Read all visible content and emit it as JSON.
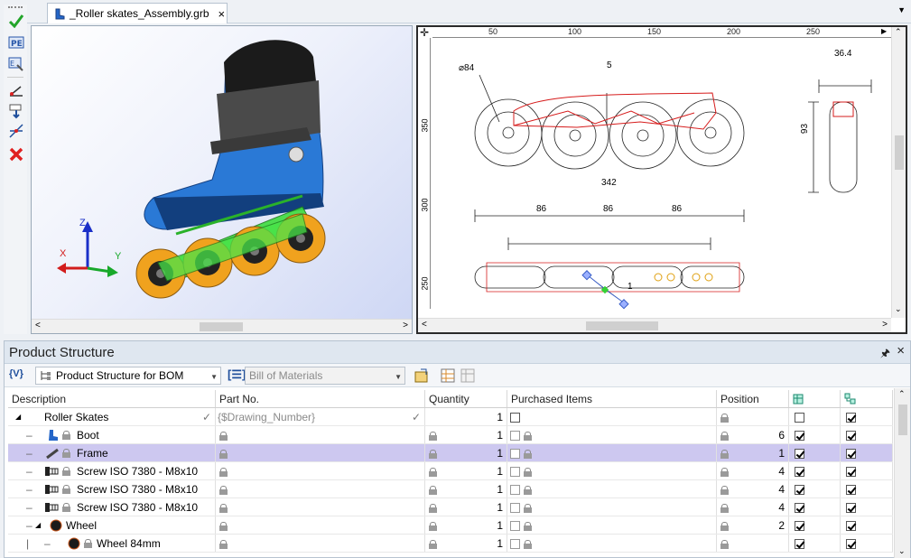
{
  "document_tab": {
    "title": "_Roller skates_Assembly.grb",
    "close": "×"
  },
  "drawing": {
    "ruler_top": [
      "50",
      "100",
      "150",
      "200",
      "250"
    ],
    "ruler_left": [
      "350",
      "300",
      "250"
    ],
    "dims": {
      "d84": "⌀84",
      "d5": "5",
      "d36": "36.4",
      "d93": "93",
      "d342": "342",
      "d86a": "86",
      "d86b": "86",
      "d86c": "86",
      "balloon": "1"
    }
  },
  "axes": {
    "x": "X",
    "y": "Y",
    "z": "Z"
  },
  "panel": {
    "title": "Product Structure",
    "pin": "⊓",
    "close": "×"
  },
  "toolbar": {
    "var_btn": "{V}",
    "structure_select": "Product Structure for BOM",
    "report_select": "Bill of Materials"
  },
  "columns": {
    "description": "Description",
    "part_no": "Part No.",
    "quantity": "Quantity",
    "purchased": "Purchased Items",
    "position": "Position"
  },
  "rows": [
    {
      "description": "Roller Skates",
      "part_no": "{$Drawing_Number}",
      "quantity": "1",
      "position": "",
      "c6": false,
      "c7": true
    },
    {
      "description": "Boot",
      "part_no": "",
      "quantity": "1",
      "position": "6",
      "c6": true,
      "c7": true
    },
    {
      "description": "Frame",
      "part_no": "",
      "quantity": "1",
      "position": "1",
      "c6": true,
      "c7": true
    },
    {
      "description": "Screw ISO 7380 - M8x10",
      "part_no": "",
      "quantity": "1",
      "position": "4",
      "c6": true,
      "c7": true
    },
    {
      "description": "Screw ISO 7380 - M8x10",
      "part_no": "",
      "quantity": "1",
      "position": "4",
      "c6": true,
      "c7": true
    },
    {
      "description": "Screw ISO 7380 - M8x10",
      "part_no": "",
      "quantity": "1",
      "position": "4",
      "c6": true,
      "c7": true
    },
    {
      "description": "Wheel",
      "part_no": "",
      "quantity": "1",
      "position": "2",
      "c6": true,
      "c7": true
    },
    {
      "description": "Wheel 84mm",
      "part_no": "",
      "quantity": "1",
      "position": "",
      "c6": true,
      "c7": true
    }
  ],
  "colors": {
    "accent": "#1f4f9c",
    "selection": "#cdc8f0",
    "frame_green": "#3ddc3d",
    "boot_blue": "#1e6fd0",
    "wheel_orange": "#f0a21e"
  }
}
